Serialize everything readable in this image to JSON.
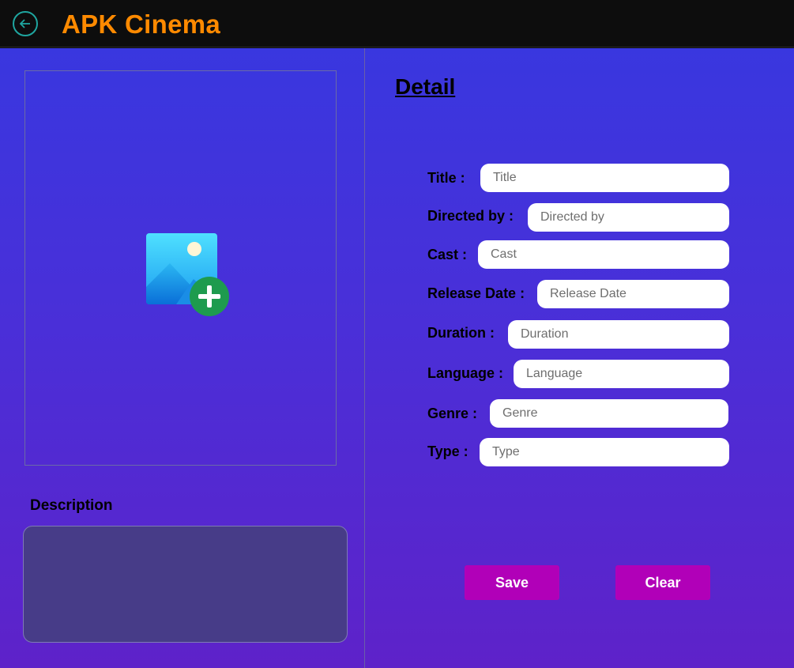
{
  "header": {
    "app_title": "APK Cinema"
  },
  "left_panel": {
    "description_label": "Description",
    "description_value": ""
  },
  "detail": {
    "heading": "Detail",
    "fields": [
      {
        "label": "Title :",
        "placeholder": "Title"
      },
      {
        "label": "Directed by :",
        "placeholder": "Directed by"
      },
      {
        "label": "Cast :",
        "placeholder": "Cast"
      },
      {
        "label": "Release Date :",
        "placeholder": "Release Date"
      },
      {
        "label": "Duration :",
        "placeholder": "Duration"
      },
      {
        "label": "Language :",
        "placeholder": "Language"
      },
      {
        "label": "Genre :",
        "placeholder": "Genre"
      },
      {
        "label": "Type :",
        "placeholder": "Type"
      }
    ]
  },
  "actions": {
    "save_label": "Save",
    "clear_label": "Clear"
  },
  "colors": {
    "title_orange": "#ff8a00",
    "button_magenta": "#b100b8",
    "back_teal": "#1fa6a0",
    "gradient_top": "#3937df",
    "gradient_bottom": "#5e22c9"
  },
  "icons": {
    "back": "arrow-left-circle-icon",
    "add_image": "image-add-icon"
  }
}
